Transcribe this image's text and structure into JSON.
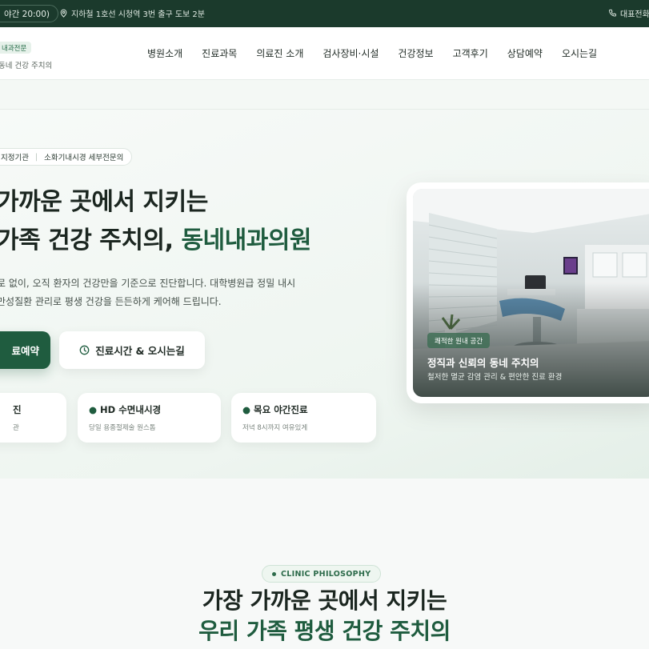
{
  "topbar": {
    "hours_pill": "야간 20:00)",
    "location": "지하철 1호선 시청역 3번 출구 도보 2분",
    "phone_label": "대표전화"
  },
  "header": {
    "logo_badge": "내과전문",
    "logo_sub": "동네 건강 주치의",
    "nav": [
      "병원소개",
      "진료과목",
      "의료진 소개",
      "검사장비·시설",
      "건강정보",
      "고객후기",
      "상담예약",
      "오시는길"
    ]
  },
  "hero": {
    "chip_left": "지정기관",
    "chip_right": "소화기내시경 세부전문의",
    "title_line1": "가까운 곳에서 지키는",
    "title_line2_plain": "가족 건강 주치의, ",
    "title_line2_accent": "동네내과의원",
    "lead_line1": "로 없이, 오직 환자의 건강만을 기준으로 진단합니다. 대학병원급 정밀 내시",
    "lead_line2": "만성질환 관리로 평생 건강을 든든하게 케어해 드립니다.",
    "primary_button": "료예약",
    "secondary_button": "진료시간 & 오시는길",
    "features": [
      {
        "title": "진",
        "desc": "관"
      },
      {
        "title": "HD 수면내시경",
        "desc": "당일 용종절제술 원스톱"
      },
      {
        "title": "목요 야간진료",
        "desc": "저녁 8시까지 여유있게"
      }
    ],
    "image_card": {
      "badge": "쾌적한 원내 공간",
      "title": "정직과 신뢰의 동네 주치의",
      "subtitle": "철저한 멸균 감염 관리 & 편안한 진료 환경"
    }
  },
  "philosophy": {
    "chip": "CLINIC PHILOSOPHY",
    "title_line1": "가장 가까운 곳에서 지키는",
    "title_line2": "우리 가족 평생 건강 주치의"
  },
  "colors": {
    "brand_green": "#1f5c3f",
    "topbar_bg": "#1b3a2c",
    "accent_green_light": "#eef6f0"
  }
}
